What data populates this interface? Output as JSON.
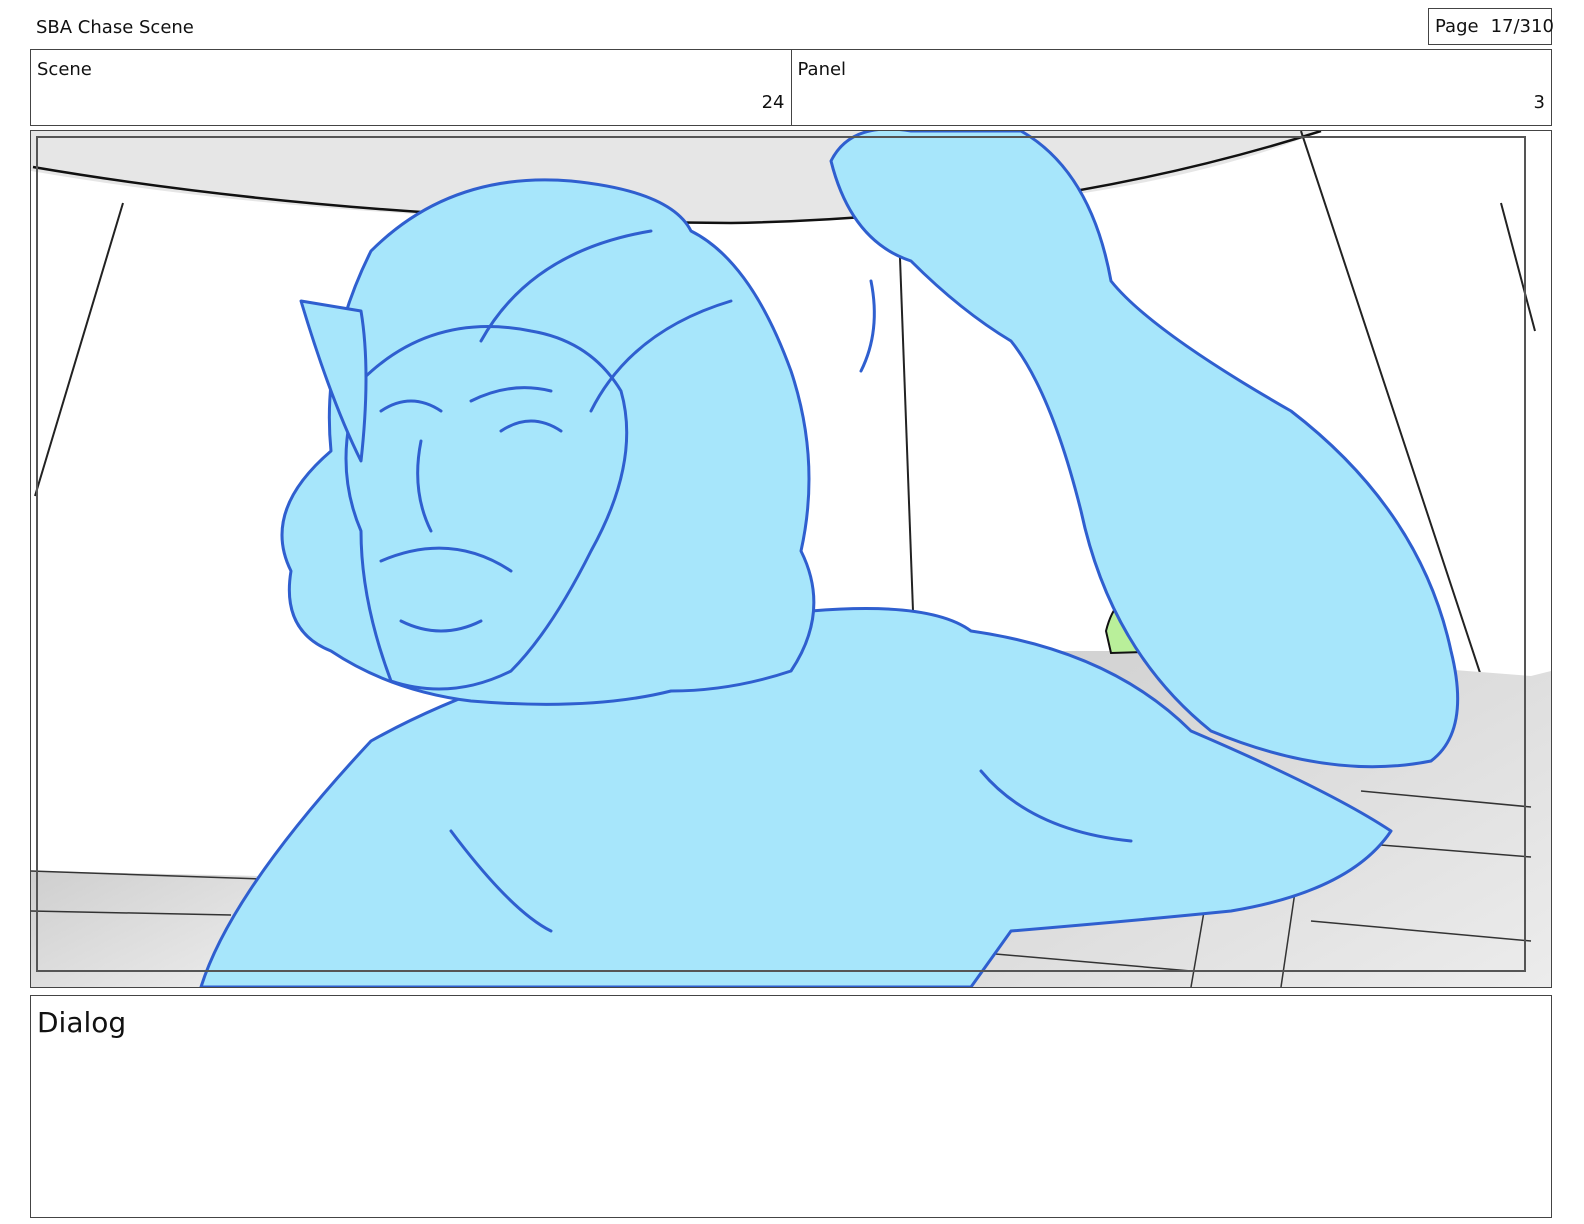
{
  "header": {
    "document_title": "SBA Chase Scene",
    "page_label": "Page",
    "page_number": "17/310"
  },
  "info": {
    "scene_label": "Scene",
    "scene_value": "24",
    "panel_label": "Panel",
    "panel_value": "3"
  },
  "dialog": {
    "label": "Dialog",
    "text": ""
  },
  "colors": {
    "character_fill": "#a7e6fb",
    "character_line": "#2f5fcf",
    "creature_fill": "#b9ef9a",
    "floor_gray": "#d7d7d7"
  }
}
